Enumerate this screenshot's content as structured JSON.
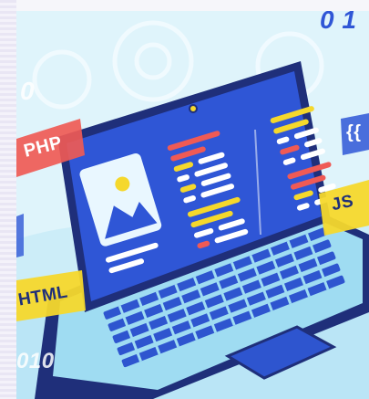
{
  "illustration": {
    "tags": {
      "php": "PHP",
      "html": "HTML",
      "js": "JS",
      "braces": "{{"
    },
    "binary": {
      "top_right": "0 1",
      "top_left": "0",
      "bottom_left": "010"
    },
    "colors": {
      "background": "#dff4fb",
      "laptop_body": "#3a5fd9",
      "laptop_outline": "#1f2f7a",
      "screen": "#2f56d6",
      "keyboard_deck": "#9fdcf2",
      "keys": "#2e55cf",
      "accent_red": "#ef5a55",
      "accent_yellow": "#f5d82c",
      "text_white": "#ffffff"
    }
  }
}
